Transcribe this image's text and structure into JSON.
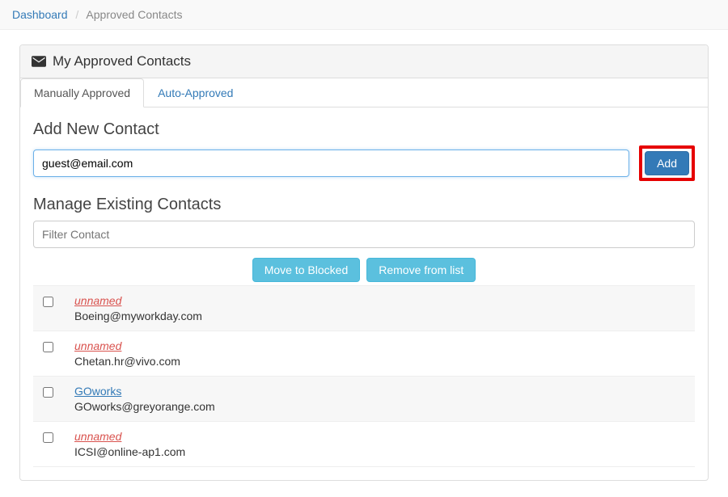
{
  "breadcrumb": {
    "root": "Dashboard",
    "current": "Approved Contacts",
    "sep": "/"
  },
  "panel": {
    "title": "My Approved Contacts"
  },
  "tabs": [
    {
      "label": "Manually Approved",
      "active": true
    },
    {
      "label": "Auto-Approved",
      "active": false
    }
  ],
  "add": {
    "title": "Add New Contact",
    "value": "guest@email.com",
    "button": "Add"
  },
  "manage": {
    "title": "Manage Existing Contacts",
    "filter_placeholder": "Filter Contact",
    "move_button": "Move to Blocked",
    "remove_button": "Remove from list"
  },
  "contacts": [
    {
      "name": "unnamed",
      "email": "Boeing@myworkday.com",
      "named": false
    },
    {
      "name": "unnamed",
      "email": "Chetan.hr@vivo.com",
      "named": false
    },
    {
      "name": "GOworks",
      "email": "GOworks@greyorange.com",
      "named": true
    },
    {
      "name": "unnamed",
      "email": "ICSI@online-ap1.com",
      "named": false
    }
  ]
}
